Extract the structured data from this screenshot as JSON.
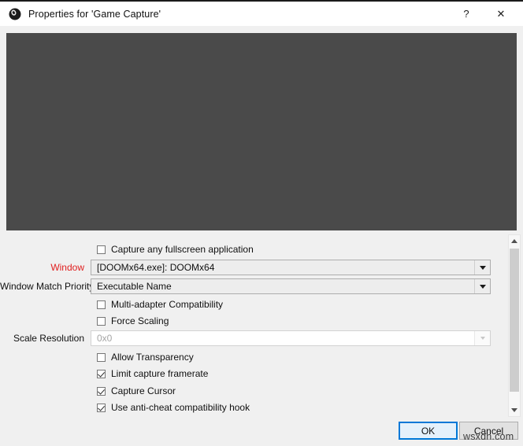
{
  "titlebar": {
    "icon": "obs-logo-icon",
    "title": "Properties for 'Game Capture'",
    "help_label": "?",
    "close_label": "✕"
  },
  "preview": {
    "background_color": "#4a4a4a"
  },
  "form": {
    "required_label_color": "#e02020",
    "rows": [
      {
        "type": "checkbox",
        "name": "capture-any-fullscreen-application",
        "label": "Capture any fullscreen application",
        "checked": false
      },
      {
        "type": "combo",
        "name": "window",
        "label": "Window",
        "required": true,
        "value": "[DOOMx64.exe]: DOOMx64",
        "disabled": false
      },
      {
        "type": "combo",
        "name": "window-match-priority",
        "label": "Window Match Priority",
        "required": false,
        "value": "Executable Name",
        "disabled": false
      },
      {
        "type": "checkbox",
        "name": "multi-adapter-compatibility",
        "label": "Multi-adapter Compatibility",
        "checked": false
      },
      {
        "type": "checkbox",
        "name": "force-scaling",
        "label": "Force Scaling",
        "checked": false
      },
      {
        "type": "combo",
        "name": "scale-resolution",
        "label": "Scale Resolution",
        "required": false,
        "value": "0x0",
        "disabled": true
      },
      {
        "type": "checkbox",
        "name": "allow-transparency",
        "label": "Allow Transparency",
        "checked": false
      },
      {
        "type": "checkbox",
        "name": "limit-capture-framerate",
        "label": "Limit capture framerate",
        "checked": true
      },
      {
        "type": "checkbox",
        "name": "capture-cursor",
        "label": "Capture Cursor",
        "checked": true
      },
      {
        "type": "checkbox",
        "name": "use-anti-cheat-compatibility-hook",
        "label": "Use anti-cheat compatibility hook",
        "checked": true
      }
    ]
  },
  "scrollbar": {
    "up_arrow": "chevron-up-icon",
    "down_arrow": "chevron-down-icon"
  },
  "buttons": {
    "ok_label": "OK",
    "cancel_label": "Cancel",
    "focus_color": "#0078d7"
  },
  "watermark": {
    "text": "wsxdn.com"
  }
}
